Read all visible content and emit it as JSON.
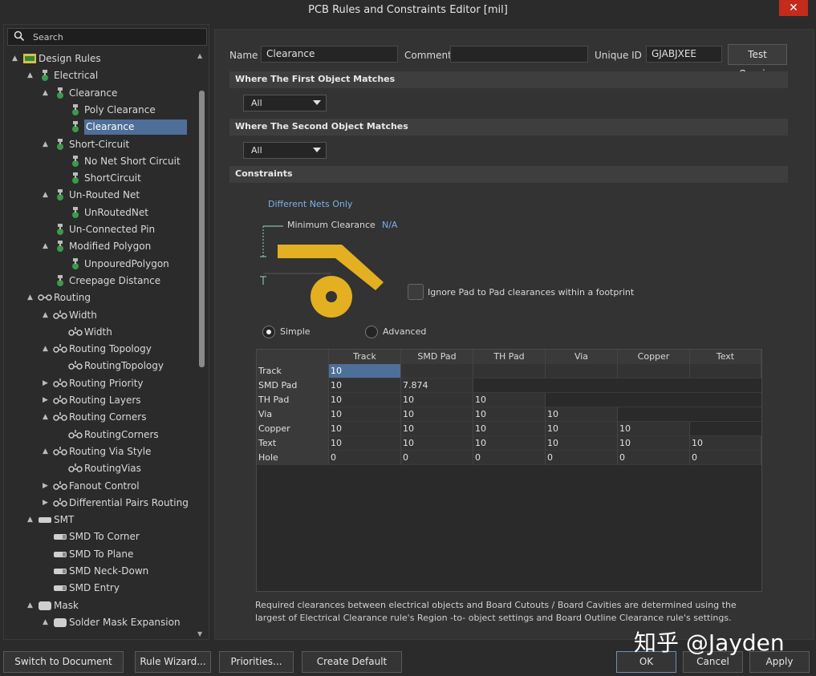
{
  "window": {
    "title": "PCB Rules and Constraints Editor [mil]",
    "close_glyph": "✕"
  },
  "search": {
    "placeholder": "Search"
  },
  "tree": [
    {
      "label": "Design Rules",
      "icon": "design-rules-icon",
      "arrow": "▲",
      "expanded": true
    },
    {
      "label": "Electrical",
      "icon": "rule-category-icon",
      "arrow": "▲",
      "expanded": true
    },
    {
      "label": "Clearance",
      "icon": "rule-type-icon",
      "arrow": "▲",
      "expanded": true
    },
    {
      "label": "Poly Clearance",
      "icon": "rule-icon",
      "arrow": ""
    },
    {
      "label": "Clearance",
      "icon": "rule-icon",
      "arrow": "",
      "selected": true
    },
    {
      "label": "Short-Circuit",
      "icon": "rule-type-icon",
      "arrow": "▲",
      "expanded": true
    },
    {
      "label": "No Net Short Circuit",
      "icon": "rule-icon",
      "arrow": ""
    },
    {
      "label": "ShortCircuit",
      "icon": "rule-icon",
      "arrow": ""
    },
    {
      "label": "Un-Routed Net",
      "icon": "rule-type-icon",
      "arrow": "▲",
      "expanded": true
    },
    {
      "label": "UnRoutedNet",
      "icon": "rule-icon",
      "arrow": ""
    },
    {
      "label": "Un-Connected Pin",
      "icon": "rule-type-icon",
      "arrow": ""
    },
    {
      "label": "Modified Polygon",
      "icon": "rule-type-icon",
      "arrow": "▲",
      "expanded": true
    },
    {
      "label": "UnpouredPolygon",
      "icon": "rule-icon",
      "arrow": ""
    },
    {
      "label": "Creepage Distance",
      "icon": "rule-type-icon",
      "arrow": ""
    },
    {
      "label": "Routing",
      "icon": "routing-category-icon",
      "arrow": "▲",
      "expanded": true
    },
    {
      "label": "Width",
      "icon": "routing-rule-icon",
      "arrow": "▲",
      "expanded": true
    },
    {
      "label": "Width",
      "icon": "routing-rule-icon",
      "arrow": ""
    },
    {
      "label": "Routing Topology",
      "icon": "routing-rule-icon",
      "arrow": "▲",
      "expanded": true
    },
    {
      "label": "RoutingTopology",
      "icon": "routing-rule-icon",
      "arrow": ""
    },
    {
      "label": "Routing Priority",
      "icon": "routing-rule-icon",
      "arrow": "▶"
    },
    {
      "label": "Routing Layers",
      "icon": "routing-rule-icon",
      "arrow": "▶"
    },
    {
      "label": "Routing Corners",
      "icon": "routing-rule-icon",
      "arrow": "▲",
      "expanded": true
    },
    {
      "label": "RoutingCorners",
      "icon": "routing-rule-icon",
      "arrow": ""
    },
    {
      "label": "Routing Via Style",
      "icon": "routing-rule-icon",
      "arrow": "▲",
      "expanded": true
    },
    {
      "label": "RoutingVias",
      "icon": "routing-rule-icon",
      "arrow": ""
    },
    {
      "label": "Fanout Control",
      "icon": "routing-rule-icon",
      "arrow": "▶"
    },
    {
      "label": "Differential Pairs Routing",
      "icon": "routing-rule-icon",
      "arrow": "▶"
    },
    {
      "label": "SMT",
      "icon": "smt-category-icon",
      "arrow": "▲",
      "expanded": true
    },
    {
      "label": "SMD To Corner",
      "icon": "smt-rule-icon",
      "arrow": ""
    },
    {
      "label": "SMD To Plane",
      "icon": "smt-rule-icon",
      "arrow": ""
    },
    {
      "label": "SMD Neck-Down",
      "icon": "smt-rule-icon",
      "arrow": ""
    },
    {
      "label": "SMD Entry",
      "icon": "smt-rule-icon",
      "arrow": ""
    },
    {
      "label": "Mask",
      "icon": "mask-category-icon",
      "arrow": "▲",
      "expanded": true
    },
    {
      "label": "Solder Mask Expansion",
      "icon": "mask-rule-icon",
      "arrow": "▲",
      "expanded": true
    }
  ],
  "rule": {
    "name_label": "Name",
    "name_value": "Clearance",
    "comment_label": "Comment",
    "comment_value": "",
    "uid_label": "Unique ID",
    "uid_value": "GJABJXEE",
    "test_queries": "Test Queries"
  },
  "sections": {
    "first": "Where The First Object Matches",
    "second": "Where The Second Object Matches",
    "constraints": "Constraints"
  },
  "first_match": "All",
  "second_match": "All",
  "constraints": {
    "net_scope": "Different Nets Only",
    "min_clearance_label": "Minimum Clearance",
    "min_clearance_value": "N/A",
    "ignore_pad_label": "Ignore Pad to Pad clearances within a footprint",
    "ignore_pad_checked": false,
    "mode_simple": "Simple",
    "mode_advanced": "Advanced",
    "mode_selected": "Simple"
  },
  "grid": {
    "columns": [
      "",
      "Track",
      "SMD Pad",
      "TH Pad",
      "Via",
      "Copper",
      "Text"
    ],
    "rows": [
      {
        "label": "Track",
        "values": [
          "10"
        ]
      },
      {
        "label": "SMD Pad",
        "values": [
          "10",
          "7.874"
        ]
      },
      {
        "label": "TH Pad",
        "values": [
          "10",
          "10",
          "10"
        ]
      },
      {
        "label": "Via",
        "values": [
          "10",
          "10",
          "10",
          "10"
        ]
      },
      {
        "label": "Copper",
        "values": [
          "10",
          "10",
          "10",
          "10",
          "10"
        ]
      },
      {
        "label": "Text",
        "values": [
          "10",
          "10",
          "10",
          "10",
          "10",
          "10"
        ]
      },
      {
        "label": "Hole",
        "values": [
          "0",
          "0",
          "0",
          "0",
          "0",
          "0"
        ]
      }
    ]
  },
  "note": "Required clearances between electrical objects and Board Cutouts / Board Cavities are determined using the largest of Electrical Clearance rule's Region -to- object settings and Board Outline Clearance rule's settings.",
  "buttons": {
    "switch_view": "Switch to Document View",
    "rule_wizard": "Rule Wizard...",
    "priorities": "Priorities...",
    "create_default": "Create Default Rules",
    "ok": "OK",
    "cancel": "Cancel",
    "apply": "Apply"
  },
  "watermark": "知乎 @Jayden",
  "colors": {
    "accent": "#4e6f98",
    "diagram_gold": "#e2b021",
    "link_blue": "#7fb0e8"
  }
}
